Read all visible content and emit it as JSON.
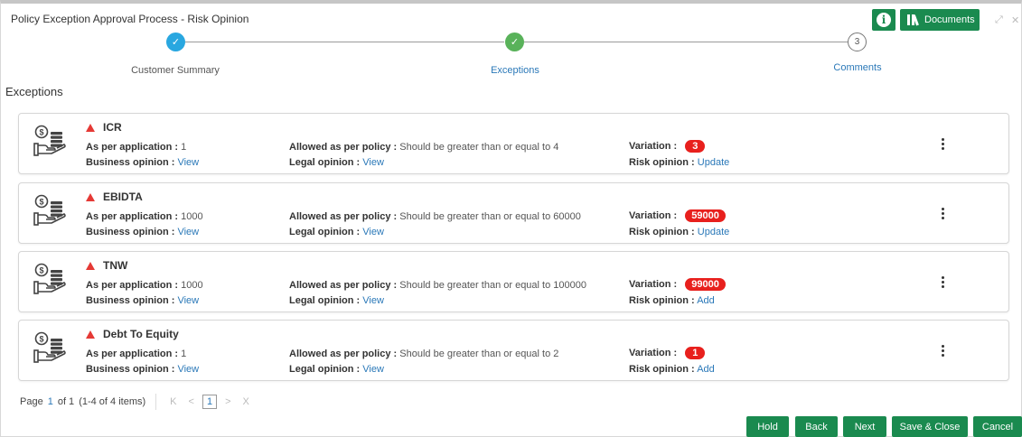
{
  "header": {
    "title": "Policy Exception Approval Process - Risk Opinion",
    "documents_label": "Documents",
    "info_glyph": "i",
    "minimize_glyph": "⤢",
    "close_glyph": "✕"
  },
  "stepper": {
    "steps": [
      {
        "label": "Customer Summary",
        "state": "done",
        "glyph": "✓"
      },
      {
        "label": "Exceptions",
        "state": "current",
        "glyph": "✓"
      },
      {
        "label": "Comments",
        "state": "pending",
        "glyph": "3"
      }
    ]
  },
  "section_title": "Exceptions",
  "labels": {
    "as_per_application": "As per application :",
    "business_opinion": "Business opinion :",
    "allowed_as_per_policy": "Allowed as per policy :",
    "legal_opinion": "Legal opinion :",
    "variation": "Variation :",
    "risk_opinion": "Risk opinion :"
  },
  "exceptions": [
    {
      "name": "ICR",
      "as_per_application": "1",
      "business_opinion": "View",
      "allowed_as_per_policy": "Should be greater than or equal to 4",
      "legal_opinion": "View",
      "variation": "3",
      "risk_opinion": "Update"
    },
    {
      "name": "EBIDTA",
      "as_per_application": "1000",
      "business_opinion": "View",
      "allowed_as_per_policy": "Should be greater than or equal to 60000",
      "legal_opinion": "View",
      "variation": "59000",
      "risk_opinion": "Update"
    },
    {
      "name": "TNW",
      "as_per_application": "1000",
      "business_opinion": "View",
      "allowed_as_per_policy": "Should be greater than or equal to 100000",
      "legal_opinion": "View",
      "variation": "99000",
      "risk_opinion": "Add"
    },
    {
      "name": "Debt To Equity",
      "as_per_application": "1",
      "business_opinion": "View",
      "allowed_as_per_policy": "Should be greater than or equal to 2",
      "legal_opinion": "View",
      "variation": "1",
      "risk_opinion": "Add"
    }
  ],
  "pager": {
    "page_label": "Page",
    "page": "1",
    "of_label": "of 1",
    "items": "(1-4 of 4 items)",
    "first": "K",
    "prev": "<",
    "current": "1",
    "next": ">",
    "last": "X"
  },
  "footer": {
    "hold": "Hold",
    "back": "Back",
    "next": "Next",
    "save_close": "Save & Close",
    "cancel": "Cancel"
  },
  "colors": {
    "primary_button": "#1a8a4f",
    "step_done": "#29a7e0",
    "step_current": "#59b25a",
    "badge": "#e8201d",
    "link": "#2a78b8",
    "warning": "#e53935"
  },
  "icons": {
    "card": "money-hand-icon",
    "warning": "warning-triangle-icon",
    "menu": "kebab-menu-icon"
  }
}
